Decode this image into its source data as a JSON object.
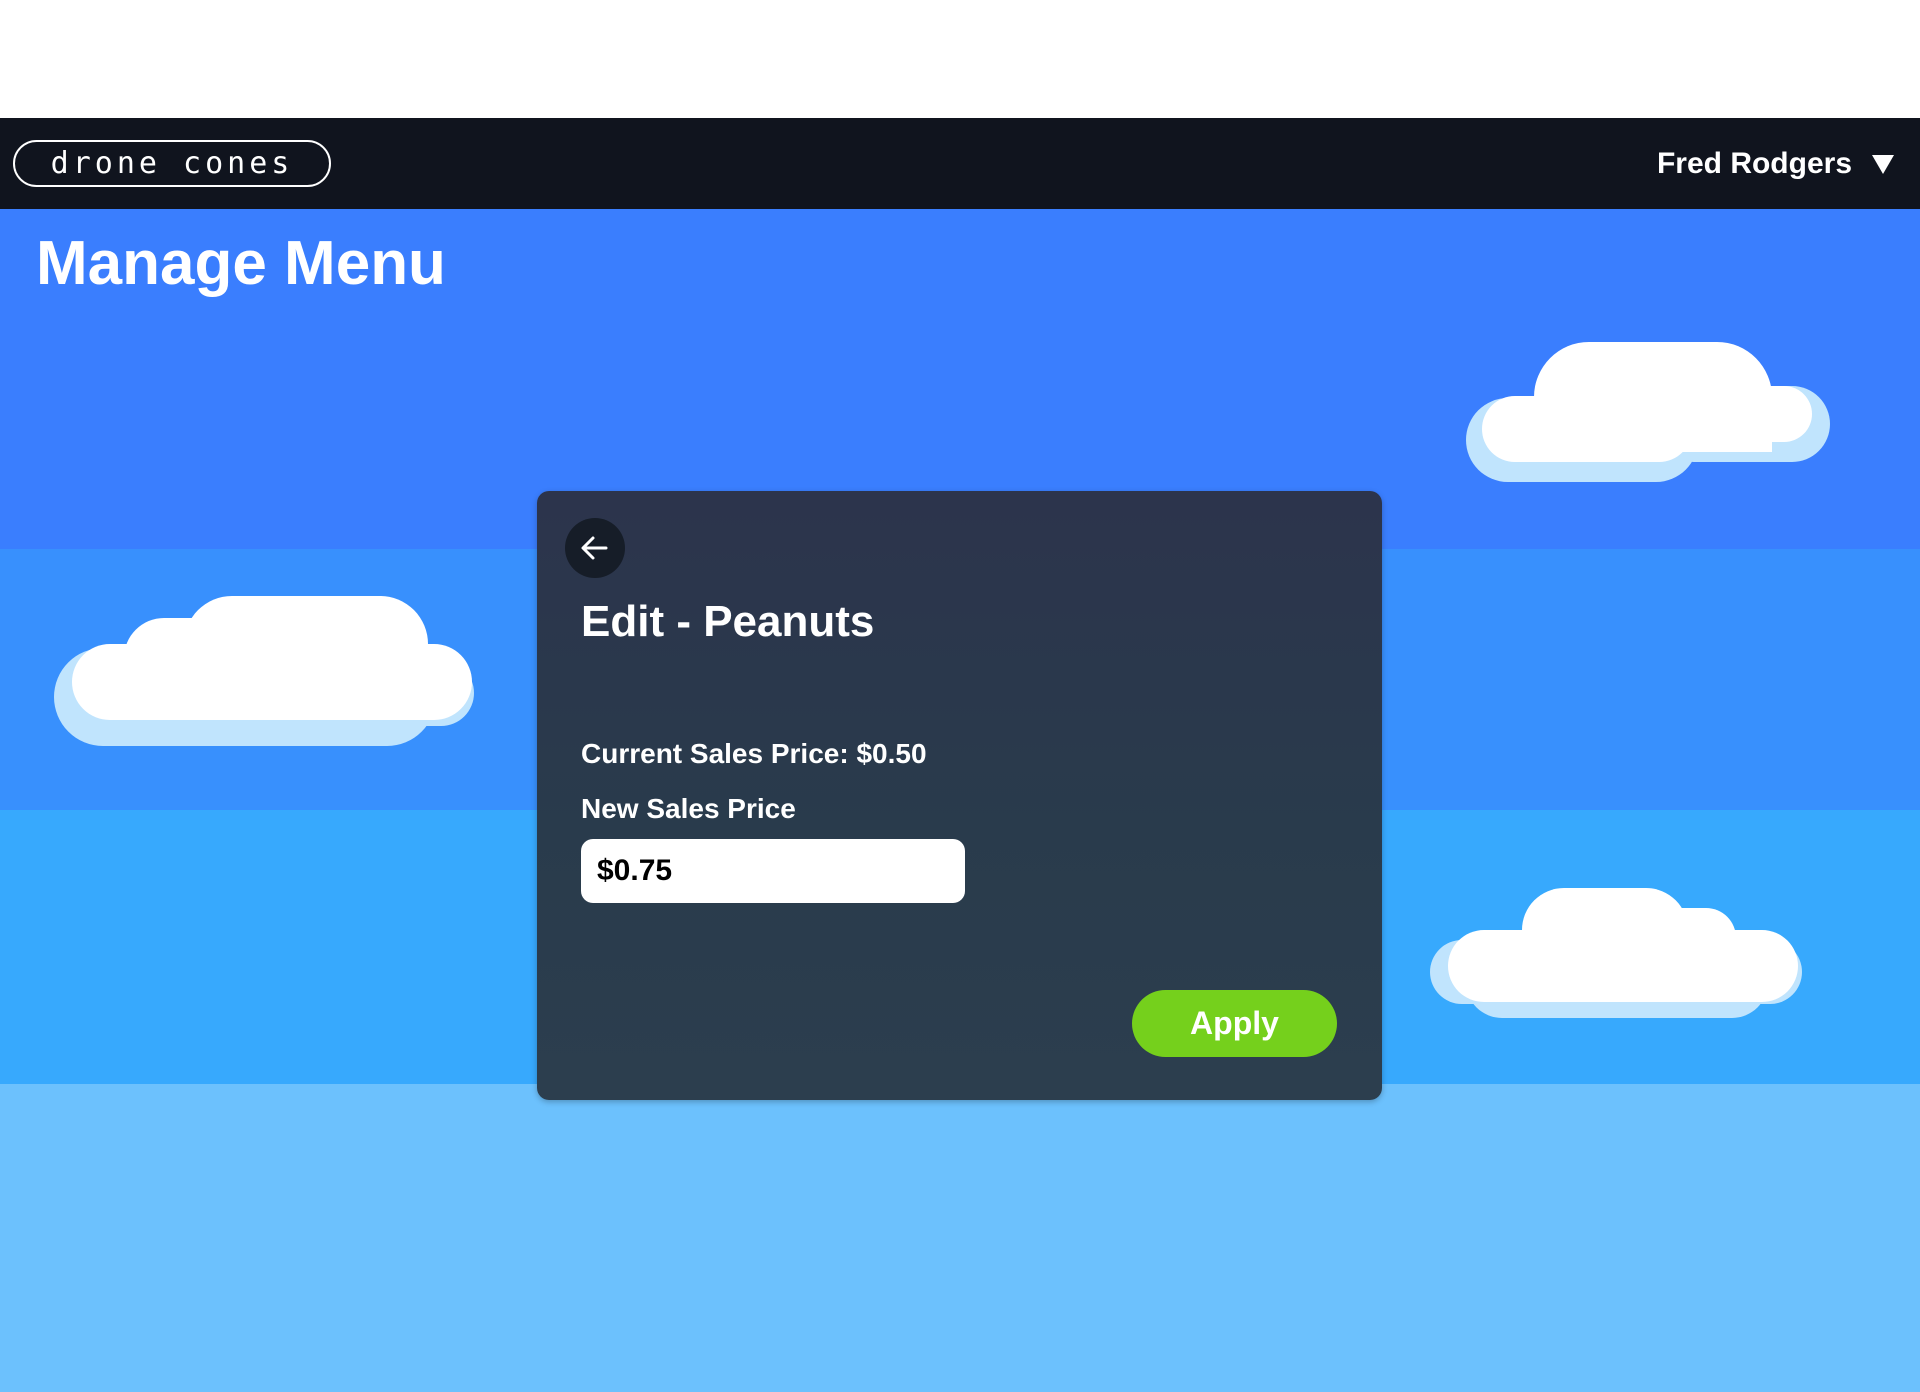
{
  "header": {
    "logo_text": "drone cones",
    "user_name": "Fred Rodgers",
    "user_menu_icon": "caret-down-icon"
  },
  "page": {
    "title": "Manage Menu"
  },
  "modal": {
    "back_icon": "arrow-left-icon",
    "title": "Edit - Peanuts",
    "current_price_text": "Current Sales Price: $0.50",
    "new_price_label": "New Sales Price",
    "new_price_value": "$0.75",
    "apply_label": "Apply"
  },
  "colors": {
    "navbar": "#10141e",
    "sky_band_1": "#3a7efe",
    "sky_band_2": "#3890fd",
    "sky_band_3": "#37a9fd",
    "sky_band_4": "#6cc1fd",
    "modal_bg": "#2a3a4c",
    "apply_button": "#75d01c"
  }
}
